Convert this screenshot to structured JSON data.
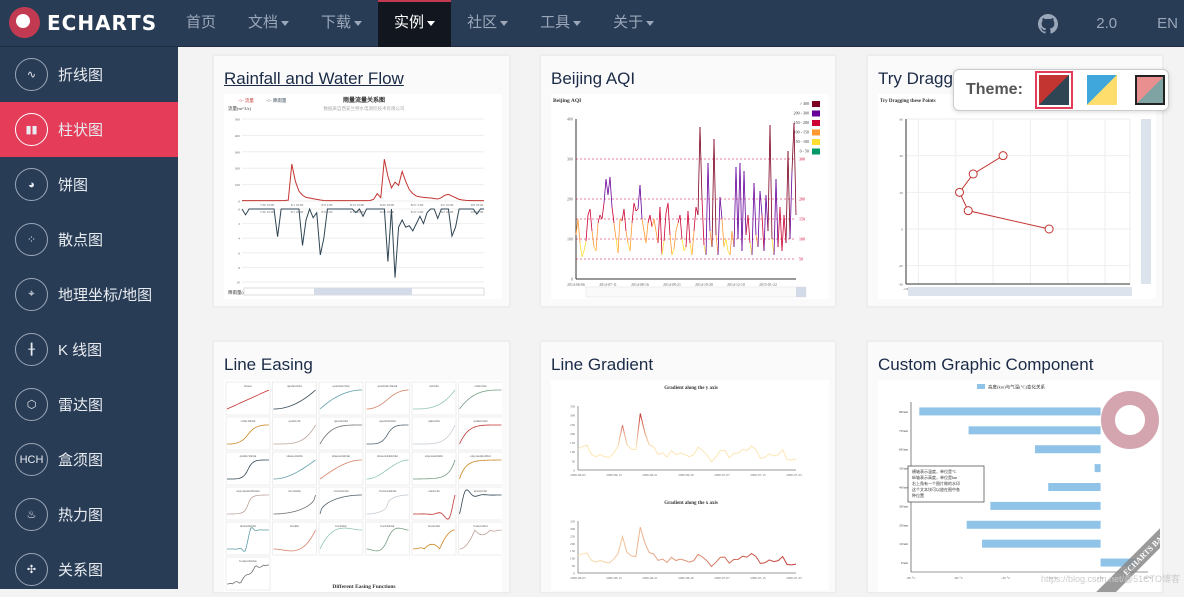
{
  "header": {
    "logo_text": "ECHARTS",
    "nav": [
      {
        "label": "首页",
        "dropdown": false,
        "active": false
      },
      {
        "label": "文档",
        "dropdown": true,
        "active": false
      },
      {
        "label": "下载",
        "dropdown": true,
        "active": false
      },
      {
        "label": "实例",
        "dropdown": true,
        "active": true
      },
      {
        "label": "社区",
        "dropdown": true,
        "active": false
      },
      {
        "label": "工具",
        "dropdown": true,
        "active": false
      },
      {
        "label": "关于",
        "dropdown": true,
        "active": false
      }
    ],
    "github_icon": "github-icon",
    "version": "2.0",
    "language": "EN"
  },
  "sidebar": {
    "items": [
      {
        "label": "折线图",
        "icon": "line-chart-icon",
        "glyph": "∿",
        "active": false
      },
      {
        "label": "柱状图",
        "icon": "bar-chart-icon",
        "glyph": "▮▮",
        "active": true
      },
      {
        "label": "饼图",
        "icon": "pie-chart-icon",
        "glyph": "◕",
        "active": false
      },
      {
        "label": "散点图",
        "icon": "scatter-icon",
        "glyph": "⁘",
        "active": false
      },
      {
        "label": "地理坐标/地图",
        "icon": "map-icon",
        "glyph": "⌖",
        "active": false
      },
      {
        "label": "K 线图",
        "icon": "candlestick-icon",
        "glyph": "╂",
        "active": false
      },
      {
        "label": "雷达图",
        "icon": "radar-icon",
        "glyph": "⬡",
        "active": false
      },
      {
        "label": "盒须图",
        "icon": "boxplot-icon",
        "glyph": "HCH",
        "active": false
      },
      {
        "label": "热力图",
        "icon": "heatmap-icon",
        "glyph": "♨",
        "active": false
      },
      {
        "label": "关系图",
        "icon": "graph-icon",
        "glyph": "✣",
        "active": false
      }
    ]
  },
  "theme_picker": {
    "label": "Theme:",
    "swatches": [
      {
        "name": "dark-red",
        "c1": "#c23531",
        "c2": "#2f4554",
        "selected": true
      },
      {
        "name": "blue-yellow",
        "c1": "#3fa7dc",
        "c2": "#fedd6d",
        "selected": false
      },
      {
        "name": "light-red",
        "c1": "#e98f8f",
        "c2": "#7fa3a3",
        "selected": false
      }
    ]
  },
  "cards": [
    {
      "title": "Rainfall and Water Flow",
      "link": true
    },
    {
      "title": "Beijing AQI",
      "link": false
    },
    {
      "title": "Try Dragging these Points",
      "link": false
    },
    {
      "title": "Line Easing",
      "link": false
    },
    {
      "title": "Line Gradient",
      "link": false
    },
    {
      "title": "Custom Graphic Component",
      "link": false
    }
  ],
  "watermark": "https://blog.csdn.net/@51CTO博客",
  "chart_data": [
    {
      "type": "line",
      "title": "雨量流量关系图",
      "subtitle": "数据来自西安兰特水电测控技术有限公司",
      "legend": [
        "流量",
        "降雨量"
      ],
      "ylabel_top": "流量(m^3/s)",
      "ylabel_bottom": "降雨量(mm)",
      "x_ticks": [
        "7/26 10:00",
        "8/1 18:00",
        "8/9 2:00",
        "8/14 10:00",
        "8/20 18:00",
        "8/27 2:00",
        "9/2 10:00",
        "9/8 18:00"
      ],
      "ylim_top": [
        0,
        500
      ],
      "yticks_top": [
        0,
        100,
        200,
        300,
        400,
        500
      ],
      "ylim_bottom": [
        0,
        10
      ],
      "yticks_bottom": [
        0,
        2,
        4,
        6,
        8,
        10
      ],
      "series": [
        {
          "name": "流量",
          "color": "#c23531",
          "values": [
            2,
            2,
            2,
            2,
            2,
            2,
            2,
            2,
            2,
            2,
            2,
            2,
            3,
            5,
            225,
            120,
            60,
            35,
            22,
            18,
            14,
            10,
            6,
            3,
            2,
            2,
            2,
            2,
            2,
            2,
            2,
            2,
            2,
            2,
            2,
            2,
            3,
            10,
            45,
            20,
            255,
            150,
            80,
            115,
            95,
            180,
            120,
            70,
            45,
            30,
            25,
            22,
            20,
            18,
            15,
            12,
            20,
            35,
            40,
            30,
            20,
            10,
            6,
            4,
            3,
            2,
            2,
            2,
            2
          ]
        },
        {
          "name": "降雨量",
          "color": "#2f4554",
          "values": [
            0,
            0.8,
            0,
            0,
            0,
            0,
            0,
            0,
            0,
            0,
            3.8,
            0,
            0,
            0,
            0,
            0,
            0,
            5,
            1.5,
            0,
            1.2,
            0.5,
            6.3,
            4,
            0,
            0,
            0,
            0,
            0,
            0,
            0,
            0,
            0.5,
            0,
            1,
            0,
            0,
            0,
            0,
            0,
            0,
            7.2,
            0,
            9.4,
            2.5,
            1.5,
            2.5,
            2.3,
            3,
            2,
            1,
            2,
            0.5,
            0,
            0,
            1.3,
            0,
            0,
            0,
            3.7,
            2.5,
            0,
            0,
            0,
            0,
            0,
            0.7,
            0,
            0
          ]
        }
      ]
    },
    {
      "type": "line",
      "title": "Beijing AQI",
      "x_ticks": [
        "2014-06-06",
        "2014-07-11",
        "2014-08-16",
        "2014-09-21",
        "2014-10-28",
        "2014-12-10",
        "2015-01-22"
      ],
      "ylim": [
        0,
        400
      ],
      "yticks": [
        0,
        100,
        200,
        300,
        400
      ],
      "markLines": [
        50,
        100,
        150,
        200,
        300
      ],
      "visualMap": [
        {
          "label": "> 300",
          "color": "#7e0023"
        },
        {
          "label": "200 - 300",
          "color": "#660099"
        },
        {
          "label": "150 - 200",
          "color": "#cc0033"
        },
        {
          "label": "100 - 150",
          "color": "#ff9933"
        },
        {
          "label": "50 - 100",
          "color": "#ffde33"
        },
        {
          "label": "0 - 50",
          "color": "#096"
        }
      ],
      "values": [
        110,
        150,
        90,
        55,
        70,
        95,
        160,
        175,
        120,
        80,
        70,
        140,
        160,
        150,
        190,
        250,
        210,
        255,
        180,
        140,
        100,
        65,
        150,
        145,
        175,
        120,
        90,
        70,
        140,
        190,
        170,
        175,
        235,
        150,
        120,
        90,
        140,
        160,
        130,
        150,
        120,
        90,
        180,
        60,
        95,
        165,
        190,
        110,
        60,
        75,
        120,
        140,
        160,
        100,
        70,
        80,
        170,
        90,
        60,
        120,
        180,
        160,
        380,
        200,
        85,
        60,
        290,
        120,
        80,
        350,
        110,
        60,
        205,
        150,
        80,
        100,
        70,
        60,
        120,
        80,
        280,
        100,
        290,
        70,
        270,
        110,
        160,
        90,
        60,
        240,
        110,
        80,
        220,
        160,
        70,
        210,
        120,
        385,
        100,
        60,
        250,
        80,
        180,
        70,
        160,
        90,
        320,
        100,
        270,
        390,
        160
      ]
    },
    {
      "type": "scatter",
      "title": "Try Dragging these Points",
      "xlim": [
        -100,
        80
      ],
      "xticks": [
        -100,
        -90,
        -60,
        -30,
        0,
        30,
        60,
        80
      ],
      "ylim": [
        -30,
        60
      ],
      "yticks": [
        -30,
        -20,
        0,
        20,
        40,
        60
      ],
      "points": [
        [
          -22,
          40
        ],
        [
          -46,
          30
        ],
        [
          -57,
          20
        ],
        [
          -50,
          10
        ],
        [
          15,
          0
        ]
      ],
      "color": "#c23531"
    },
    {
      "type": "line",
      "title": "Different Easing Functions",
      "panels": [
        "linear",
        "quadraticIn",
        "quadraticOut",
        "quadraticInOut",
        "cubicIn",
        "cubicOut",
        "cubicInOut",
        "quarticIn",
        "quarticOut",
        "quarticInOut",
        "quinticIn",
        "quinticOut",
        "quinticInOut",
        "sinusoidalIn",
        "sinusoidalOut",
        "sinusoidalInOut",
        "exponentialIn",
        "exponentialOut",
        "exponentialInOut",
        "circularIn",
        "circularOut",
        "circularInOut",
        "elasticIn",
        "elasticOut",
        "elasticInOut",
        "backIn",
        "backOut",
        "backInOut",
        "bounceIn",
        "bounceOut",
        "bounceInOut"
      ],
      "colors": [
        "#c23531",
        "#2f4554",
        "#61a0a8",
        "#d48265",
        "#91c7ae",
        "#749f83",
        "#ca8622",
        "#bda29a",
        "#6e7074",
        "#546570",
        "#c4ccd3"
      ]
    },
    {
      "type": "line",
      "titles": [
        "Gradient along the y axis",
        "Gradient along the x axis"
      ],
      "x_ticks": [
        "2000-06-05",
        "2000-06-13",
        "2000-06-21",
        "2000-06-29",
        "2000-07-07",
        "2000-07-15",
        "2000-07-23"
      ],
      "ylim": [
        0,
        350
      ],
      "yticks": [
        0,
        50,
        100,
        150,
        200,
        250,
        300,
        350
      ],
      "values": [
        116,
        129,
        135,
        86,
        73,
        85,
        73,
        68,
        92,
        130,
        245,
        139,
        115,
        111,
        309,
        206,
        137,
        128,
        85,
        94,
        71,
        106,
        84,
        93,
        85,
        73,
        83,
        125,
        107,
        82,
        44,
        72,
        106,
        107,
        66,
        91,
        92,
        113,
        107,
        131,
        111,
        64,
        69,
        88,
        77,
        83,
        111,
        57,
        55,
        60
      ]
    },
    {
      "type": "bar",
      "orientation": "horizontal",
      "legend": [
        "高度(km)与气温(°C)变化关系"
      ],
      "categories": [
        "0 km",
        "10 km",
        "20 km",
        "30 km",
        "40 km",
        "50 km",
        "60 km",
        "70 km",
        "80 km"
      ],
      "values": [
        15,
        -50,
        -56.5,
        -46.5,
        -22.1,
        -2.5,
        -27.7,
        -55.7,
        -76.5
      ],
      "xlim": [
        -80,
        20
      ],
      "xticks": [
        "-80 °C",
        "-60 °C",
        "-40 °C",
        "-20 °C",
        "0 °C",
        "20 °C"
      ],
      "color": "#8fc3e8",
      "text_box": [
        "横轴表示温度，单位是°C",
        "纵轴表示高度，单位是km",
        "右上角有一个图片做的水印",
        "这个文本块可以放在图中各",
        "种位置"
      ],
      "ribbon": "ECHARTS BAR CHART"
    }
  ]
}
